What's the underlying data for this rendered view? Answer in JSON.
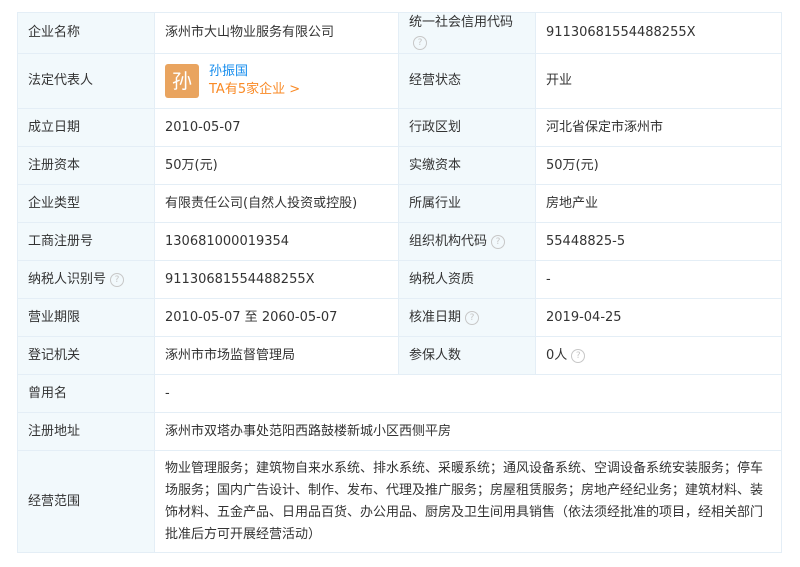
{
  "rows": {
    "r1": {
      "label_a": "企业名称",
      "value_a": "涿州市大山物业服务有限公司",
      "label_b": "统一社会信用代码",
      "value_b": "91130681554488255X"
    },
    "r2": {
      "label_a": "法定代表人",
      "avatar_char": "孙",
      "rep_name": "孙振国",
      "rep_link": "TA有5家企业 >",
      "label_b": "经营状态",
      "value_b": "开业"
    },
    "r3": {
      "label_a": "成立日期",
      "value_a": "2010-05-07",
      "label_b": "行政区划",
      "value_b": "河北省保定市涿州市"
    },
    "r4": {
      "label_a": "注册资本",
      "value_a": "50万(元)",
      "label_b": "实缴资本",
      "value_b": "50万(元)"
    },
    "r5": {
      "label_a": "企业类型",
      "value_a": "有限责任公司(自然人投资或控股)",
      "label_b": "所属行业",
      "value_b": "房地产业"
    },
    "r6": {
      "label_a": "工商注册号",
      "value_a": "130681000019354",
      "label_b": "组织机构代码",
      "value_b": "55448825-5"
    },
    "r7": {
      "label_a": "纳税人识别号",
      "value_a": "91130681554488255X",
      "label_b": "纳税人资质",
      "value_b": "-"
    },
    "r8": {
      "label_a": "营业期限",
      "value_a": "2010-05-07 至 2060-05-07",
      "label_b": "核准日期",
      "value_b": "2019-04-25"
    },
    "r9": {
      "label_a": "登记机关",
      "value_a": "涿州市市场监督管理局",
      "label_b": "参保人数",
      "value_b": "0人"
    },
    "r10": {
      "label_a": "曾用名",
      "value_a": "-"
    },
    "r11": {
      "label_a": "注册地址",
      "value_a": "涿州市双塔办事处范阳西路鼓楼新城小区西侧平房"
    },
    "r12": {
      "label_a": "经营范围",
      "value_a": "物业管理服务；建筑物自来水系统、排水系统、采暖系统；通风设备系统、空调设备系统安装服务；停车场服务；国内广告设计、制作、发布、代理及推广服务；房屋租赁服务；房地产经纪业务；建筑材料、装饰材料、五金产品、日用品百货、办公用品、厨房及卫生间用具销售（依法须经批准的项目，经相关部门批准后方可开展经营活动）"
    }
  },
  "help_glyph": "?",
  "colors": {
    "label_bg": "#f2f9fc",
    "border": "#e4eef6",
    "link_blue": "#128bed",
    "link_orange": "#f98a26",
    "avatar_bg": "#e9a45f"
  }
}
